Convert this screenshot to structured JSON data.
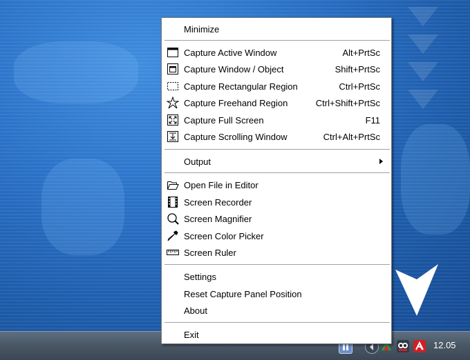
{
  "menu": {
    "minimize": "Minimize",
    "capture_items": [
      {
        "label": "Capture Active Window",
        "shortcut": "Alt+PrtSc",
        "icon": "active-window-icon"
      },
      {
        "label": "Capture Window / Object",
        "shortcut": "Shift+PrtSc",
        "icon": "window-object-icon"
      },
      {
        "label": "Capture Rectangular Region",
        "shortcut": "Ctrl+PrtSc",
        "icon": "rectangular-region-icon"
      },
      {
        "label": "Capture Freehand Region",
        "shortcut": "Ctrl+Shift+PrtSc",
        "icon": "freehand-region-icon"
      },
      {
        "label": "Capture Full Screen",
        "shortcut": "F11",
        "icon": "full-screen-icon"
      },
      {
        "label": "Capture Scrolling Window",
        "shortcut": "Ctrl+Alt+PrtSc",
        "icon": "scrolling-window-icon"
      }
    ],
    "output": "Output",
    "tool_items": [
      {
        "label": "Open File in Editor",
        "icon": "folder-open-icon"
      },
      {
        "label": "Screen Recorder",
        "icon": "film-icon"
      },
      {
        "label": "Screen Magnifier",
        "icon": "magnifier-icon"
      },
      {
        "label": "Screen Color Picker",
        "icon": "eyedropper-icon"
      },
      {
        "label": "Screen Ruler",
        "icon": "ruler-icon"
      }
    ],
    "settings": "Settings",
    "reset": "Reset Capture Panel Position",
    "about": "About",
    "exit": "Exit"
  },
  "taskbar": {
    "clock": "12.05",
    "tray_icons": [
      "language-indicator-icon",
      "back-arrow-icon",
      "network-icon",
      "capture-app-tray-icon",
      "antivirus-icon"
    ]
  }
}
